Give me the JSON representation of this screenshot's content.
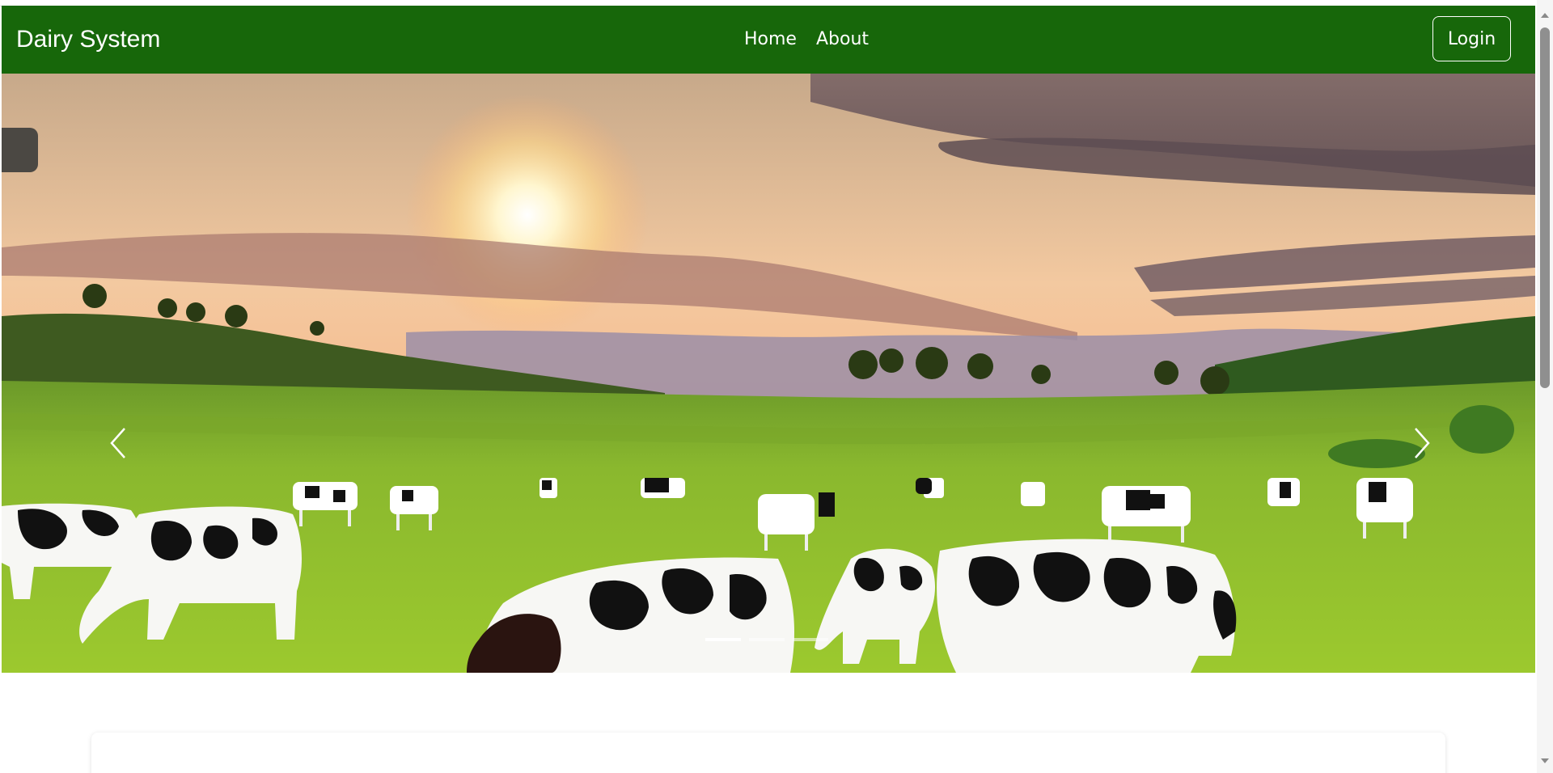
{
  "navbar": {
    "brand": "Dairy System",
    "links": [
      {
        "label": "Home"
      },
      {
        "label": "About"
      }
    ],
    "login_label": "Login",
    "background": "#17670a"
  },
  "carousel": {
    "slide_count": 3,
    "active_index": 0,
    "prev_icon": "chevron-left-icon",
    "next_icon": "chevron-right-icon",
    "image_subject": "cows-grazing-meadow-sunset"
  }
}
